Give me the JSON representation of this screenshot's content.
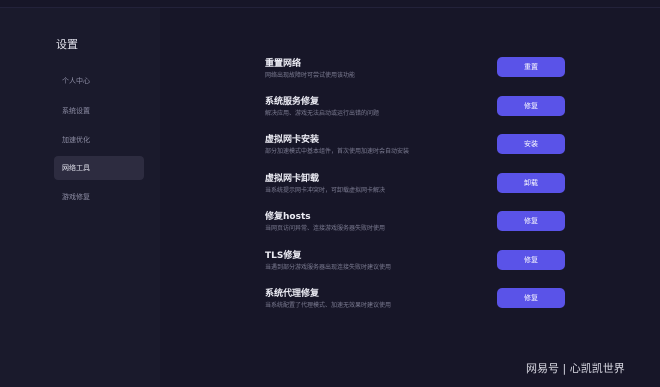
{
  "sidebar": {
    "title": "设置",
    "items": [
      {
        "label": "个人中心",
        "active": false
      },
      {
        "label": "系统设置",
        "active": false
      },
      {
        "label": "加速优化",
        "active": false
      },
      {
        "label": "网络工具",
        "active": true
      },
      {
        "label": "游戏修复",
        "active": false
      }
    ]
  },
  "tools": [
    {
      "title": "重置网络",
      "desc": "网络出现故障时可尝试使用该功能",
      "button": "重置"
    },
    {
      "title": "系统服务修复",
      "desc": "解决应用、游戏无法启动或运行出错的问题",
      "button": "修复"
    },
    {
      "title": "虚拟网卡安装",
      "desc": "部分加速模式中基本组件，首次使用加速时会自动安装",
      "button": "安装"
    },
    {
      "title": "虚拟网卡卸载",
      "desc": "当系统提示网卡冲突时，可卸载虚拟网卡解决",
      "button": "卸载"
    },
    {
      "title": "修复hosts",
      "desc": "当网页访问异常、连接游戏服务器失败时使用",
      "button": "修复"
    },
    {
      "title": "TLS修复",
      "desc": "当遇到部分游戏服务器出现连接失败时建议使用",
      "button": "修复"
    },
    {
      "title": "系统代理修复",
      "desc": "当系统配置了代理模式、加速无效果时建议使用",
      "button": "修复"
    }
  ],
  "watermark": "网易号 | 心凯凯世界",
  "colors": {
    "background": "#171628",
    "sidebar_bg": "#1a1a2c",
    "active_nav_bg": "#2d2c40",
    "button_accent": "#5a53e8"
  }
}
